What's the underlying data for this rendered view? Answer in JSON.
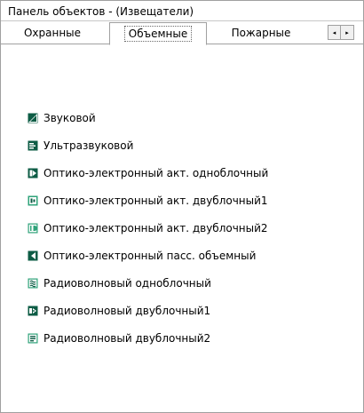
{
  "window": {
    "title": "Панель объектов - (Извещатели)"
  },
  "tabs": [
    {
      "label": "Охранные",
      "selected": false
    },
    {
      "label": "Объемные",
      "selected": true
    },
    {
      "label": "Пожарные",
      "selected": false
    }
  ],
  "tab_scroll": {
    "left_label": "◂",
    "right_label": "▸"
  },
  "items": [
    {
      "label": "Звуковой",
      "icon": "sound-detector-icon"
    },
    {
      "label": "Ультразвуковой",
      "icon": "ultrasonic-detector-icon"
    },
    {
      "label": "Оптико-электронный акт. одноблочный",
      "icon": "optoelectronic-active-single-icon"
    },
    {
      "label": "Оптико-электронный акт. двублочный1",
      "icon": "optoelectronic-active-double1-icon"
    },
    {
      "label": "Оптико-электронный акт. двублочный2",
      "icon": "optoelectronic-active-double2-icon"
    },
    {
      "label": "Оптико-электронный пасс. объемный",
      "icon": "optoelectronic-passive-volume-icon"
    },
    {
      "label": "Радиоволновый одноблочный",
      "icon": "radiowave-single-icon"
    },
    {
      "label": "Радиоволновый двублочный1",
      "icon": "radiowave-double1-icon"
    },
    {
      "label": "Радиоволновый двублочный2",
      "icon": "radiowave-double2-icon"
    }
  ],
  "colors": {
    "icon_primary": "#0d5c45",
    "icon_accent": "#2fa37a"
  }
}
